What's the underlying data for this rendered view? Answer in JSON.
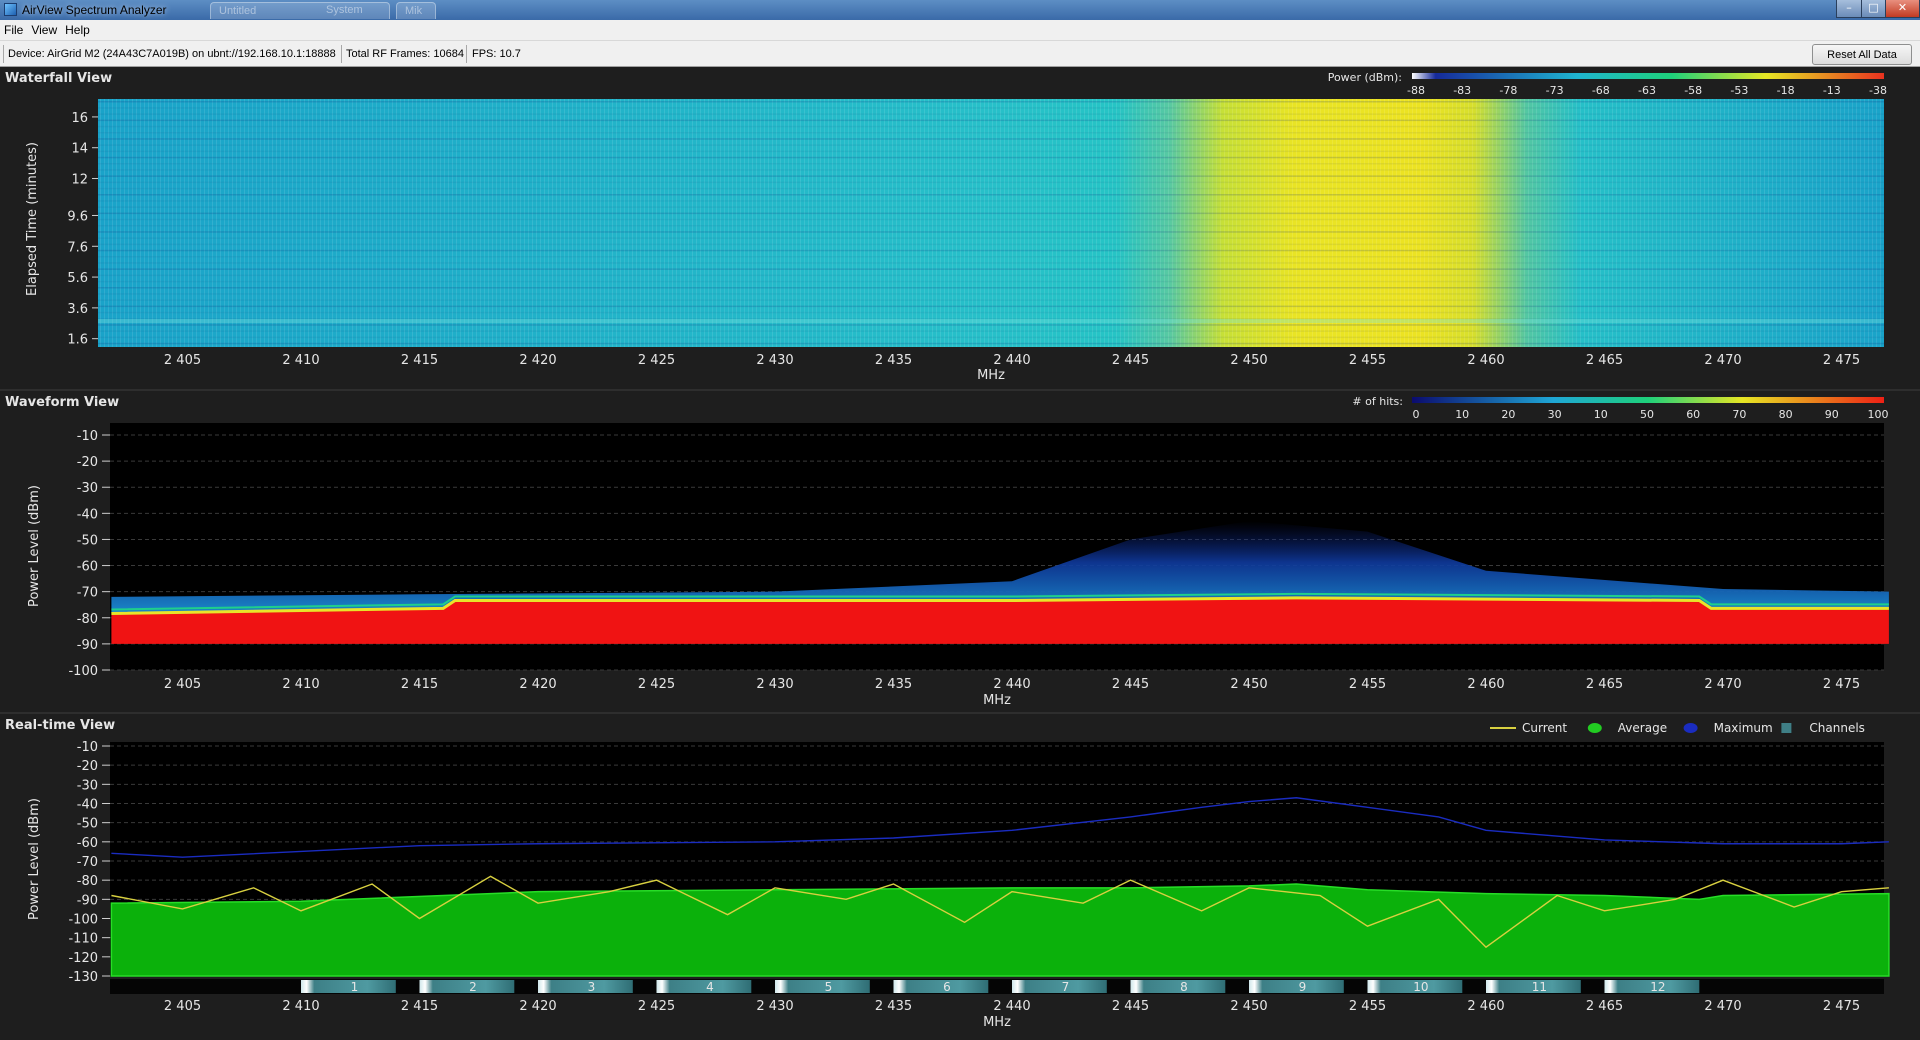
{
  "window": {
    "title": "AirView Spectrum Analyzer",
    "background_tabs": [
      "Untitled",
      "System",
      "Mik"
    ]
  },
  "menu": {
    "items": [
      "File",
      "View",
      "Help"
    ]
  },
  "toolbar": {
    "device": "Device: AirGrid M2 (24A43C7A019B) on ubnt://192.168.10.1:18888",
    "frames": "Total RF Frames: 10684",
    "fps": "FPS: 10.7",
    "reset_label": "Reset All Data"
  },
  "waterfall": {
    "title": "Waterfall View",
    "ylabel": "Elapsed Time (minutes)",
    "yticks": [
      "16",
      "14",
      "12",
      "9.6",
      "7.6",
      "5.6",
      "3.6",
      "1.6"
    ],
    "xlabel": "MHz",
    "legend_title": "Power (dBm):",
    "legend_ticks": [
      "-88",
      "-83",
      "-78",
      "-73",
      "-68",
      "-63",
      "-58",
      "-53",
      "-18",
      "-13",
      "-38"
    ]
  },
  "waveform": {
    "title": "Waveform View",
    "ylabel": "Power Level (dBm)",
    "yticks": [
      "-10",
      "-20",
      "-30",
      "-40",
      "-50",
      "-60",
      "-70",
      "-80",
      "-90",
      "-100"
    ],
    "xlabel": "MHz",
    "legend_title": "# of hits:",
    "legend_ticks": [
      "0",
      "10",
      "20",
      "30",
      "10",
      "50",
      "60",
      "70",
      "80",
      "90",
      "100"
    ]
  },
  "realtime": {
    "title": "Real-time View",
    "ylabel": "Power Level (dBm)",
    "yticks": [
      "-10",
      "-20",
      "-30",
      "-40",
      "-50",
      "-60",
      "-70",
      "-80",
      "-90",
      "-100",
      "-110",
      "-120",
      "-130"
    ],
    "xlabel": "MHz",
    "legend": [
      {
        "label": "Current",
        "color": "#d8d040"
      },
      {
        "label": "Average",
        "color": "#22cc22"
      },
      {
        "label": "Maximum",
        "color": "#1a2cc0"
      },
      {
        "label": "Channels",
        "color": "#3f7f86"
      }
    ],
    "channels": [
      "1",
      "2",
      "3",
      "4",
      "5",
      "6",
      "7",
      "8",
      "9",
      "10",
      "11",
      "12"
    ]
  },
  "xticks": [
    "2 405",
    "2 410",
    "2 415",
    "2 420",
    "2 425",
    "2 430",
    "2 435",
    "2 440",
    "2 445",
    "2 450",
    "2 455",
    "2 460",
    "2 465",
    "2 470",
    "2 475"
  ],
  "chart_data": [
    {
      "type": "heatmap",
      "title": "Waterfall View",
      "xlabel": "MHz",
      "ylabel": "Elapsed Time (minutes)",
      "xlim": [
        2402,
        2477
      ],
      "ylim": [
        0,
        17
      ],
      "colorbar": "Power (dBm)",
      "summary_by_mhz": {
        "x": [
          2405,
          2410,
          2415,
          2420,
          2425,
          2430,
          2435,
          2440,
          2443,
          2445,
          2448,
          2450,
          2453,
          2455,
          2458,
          2460,
          2465,
          2470,
          2475
        ],
        "power_dbm": [
          -80,
          -80,
          -79,
          -78,
          -78,
          -78,
          -78,
          -77,
          -74,
          -68,
          -60,
          -58,
          -58,
          -59,
          -63,
          -75,
          -79,
          -80,
          -80
        ]
      }
    },
    {
      "type": "heatmap",
      "title": "Waveform View",
      "xlabel": "MHz",
      "ylabel": "Power Level (dBm)",
      "xlim": [
        2402,
        2477
      ],
      "ylim": [
        -100,
        -5
      ],
      "colorbar": "# of hits",
      "noise_floor_dbm": {
        "x": [
          2402,
          2416,
          2416.5,
          2440,
          2452,
          2469,
          2469.5,
          2477
        ],
        "y": [
          -78,
          -76,
          -73,
          -73,
          -72,
          -73,
          -76,
          -76
        ]
      },
      "max_envelope_dbm": {
        "x": [
          2402,
          2415,
          2430,
          2440,
          2445,
          2450,
          2455,
          2460,
          2470,
          2477
        ],
        "y": [
          -72,
          -71,
          -70,
          -66,
          -50,
          -43,
          -47,
          -62,
          -69,
          -70
        ]
      }
    },
    {
      "type": "line",
      "title": "Real-time View",
      "xlabel": "MHz",
      "ylabel": "Power Level (dBm)",
      "xlim": [
        2402,
        2477
      ],
      "ylim": [
        -130,
        -10
      ],
      "series": [
        {
          "name": "Average",
          "x": [
            2402,
            2410,
            2416,
            2420,
            2430,
            2440,
            2445,
            2450,
            2452,
            2455,
            2460,
            2465,
            2469,
            2470,
            2477
          ],
          "y": [
            -92,
            -91,
            -88,
            -86,
            -85,
            -84,
            -84,
            -83,
            -82,
            -85,
            -87,
            -88,
            -90,
            -88,
            -87
          ]
        },
        {
          "name": "Maximum",
          "x": [
            2402,
            2405,
            2410,
            2415,
            2420,
            2430,
            2435,
            2440,
            2445,
            2448,
            2450,
            2452,
            2455,
            2458,
            2460,
            2465,
            2470,
            2475,
            2477
          ],
          "y": [
            -66,
            -68,
            -65,
            -62,
            -61,
            -60,
            -58,
            -54,
            -47,
            -42,
            -39,
            -37,
            -42,
            -47,
            -54,
            -59,
            -61,
            -61,
            -60
          ]
        },
        {
          "name": "Current",
          "x": [
            2402,
            2405,
            2408,
            2410,
            2413,
            2415,
            2418,
            2420,
            2423,
            2425,
            2428,
            2430,
            2433,
            2435,
            2438,
            2440,
            2443,
            2445,
            2448,
            2450,
            2453,
            2455,
            2458,
            2460,
            2463,
            2465,
            2468,
            2470,
            2473,
            2475,
            2477
          ],
          "y": [
            -88,
            -95,
            -84,
            -96,
            -82,
            -100,
            -78,
            -92,
            -86,
            -80,
            -98,
            -84,
            -90,
            -82,
            -102,
            -86,
            -92,
            -80,
            -96,
            -84,
            -88,
            -104,
            -90,
            -115,
            -88,
            -96,
            -90,
            -80,
            -94,
            -86,
            -84
          ]
        }
      ],
      "channels": {
        "labels": [
          "1",
          "2",
          "3",
          "4",
          "5",
          "6",
          "7",
          "8",
          "9",
          "10",
          "11",
          "12"
        ],
        "center_mhz": [
          2412,
          2417,
          2422,
          2427,
          2432,
          2437,
          2442,
          2447,
          2452,
          2457,
          2462,
          2467
        ]
      }
    }
  ]
}
